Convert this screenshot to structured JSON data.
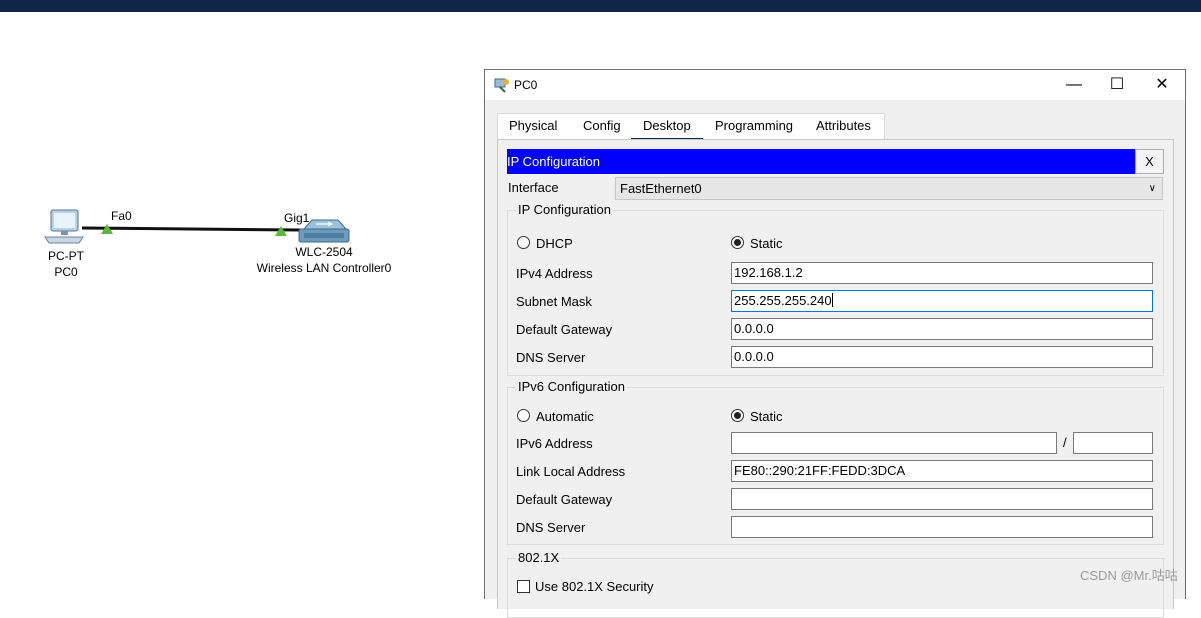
{
  "topology": {
    "pc": {
      "type_label": "PC-PT",
      "name": "PC0",
      "port": "Fa0"
    },
    "wlc": {
      "model": "WLC-2504",
      "name": "Wireless LAN Controller0",
      "port": "Gig1"
    }
  },
  "window": {
    "title": "PC0",
    "controls": {
      "minimize": "—",
      "maximize": "☐",
      "close": "✕"
    },
    "tabs": [
      {
        "label": "Physical"
      },
      {
        "label": "Config"
      },
      {
        "label": "Desktop",
        "active": true
      },
      {
        "label": "Programming"
      },
      {
        "label": "Attributes"
      }
    ]
  },
  "ipconfig": {
    "header": "IP Configuration",
    "close_label": "X",
    "interface_label": "Interface",
    "interface_value": "FastEthernet0",
    "ipv4": {
      "title": "IP Configuration",
      "dhcp_label": "DHCP",
      "static_label": "Static",
      "mode": "Static",
      "ipv4_address_label": "IPv4 Address",
      "ipv4_address": "192.168.1.2",
      "subnet_mask_label": "Subnet Mask",
      "subnet_mask": "255.255.255.240",
      "default_gateway_label": "Default Gateway",
      "default_gateway": "0.0.0.0",
      "dns_server_label": "DNS Server",
      "dns_server": "0.0.0.0"
    },
    "ipv6": {
      "title": "IPv6 Configuration",
      "automatic_label": "Automatic",
      "static_label": "Static",
      "mode": "Static",
      "ipv6_address_label": "IPv6 Address",
      "ipv6_address": "",
      "prefix_separator": "/",
      "prefix_length": "",
      "link_local_label": "Link Local Address",
      "link_local": "FE80::290:21FF:FEDD:3DCA",
      "default_gateway_label": "Default Gateway",
      "default_gateway": "",
      "dns_server_label": "DNS Server",
      "dns_server": ""
    },
    "dot1x": {
      "title": "802.1X",
      "use_label": "Use 802.1X Security",
      "checked": false
    }
  },
  "watermark": "CSDN @Mr.咕咕",
  "colors": {
    "topbar": "#0f2447",
    "ip_header": "#0000ff",
    "tab_underline": "#0e2a4f",
    "link_green": "#4caf32"
  }
}
